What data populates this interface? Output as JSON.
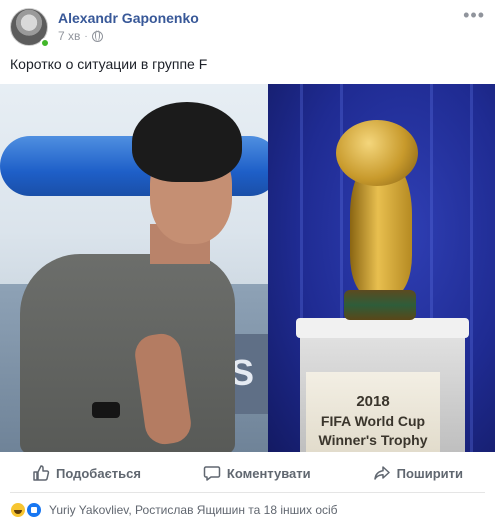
{
  "post": {
    "author": "Alexandr Gaponenko",
    "timestamp": "7 хв",
    "privacy_icon": "globe-icon",
    "more_label": "•••",
    "text": "Коротко о ситуации в группе F"
  },
  "image": {
    "banner_text": "RES",
    "plaque": [
      "2018",
      "FIFA World Cup",
      "Winner's Trophy"
    ]
  },
  "actions": {
    "like_label": "Подобається",
    "comment_label": "Коментувати",
    "share_label": "Поширити"
  },
  "reactions": {
    "icons": [
      "haha-icon",
      "like-icon"
    ],
    "text": "Yuriy Yakovliev, Ростислав Ящишин та 18 інших осіб"
  },
  "colors": {
    "author_link": "#385898",
    "online": "#42b72a",
    "action_text": "#606770"
  }
}
